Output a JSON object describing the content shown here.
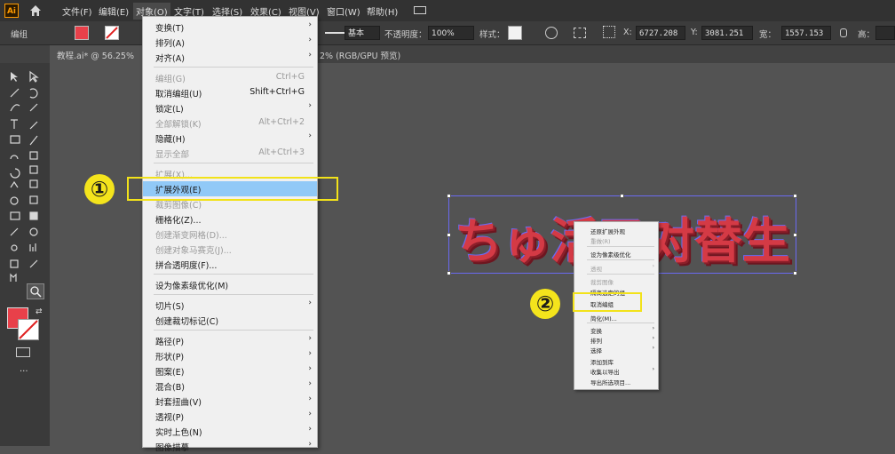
{
  "app": {
    "logo": "Ai",
    "home_icon": "home-icon"
  },
  "menubar": [
    "文件(F)",
    "编辑(E)",
    "对象(O)",
    "文字(T)",
    "选择(S)",
    "效果(C)",
    "视图(V)",
    "窗口(W)",
    "帮助(H)"
  ],
  "control": {
    "group_label": "编组",
    "stroke_style": "基本",
    "opacity_label": "不透明度：",
    "opacity_value": "100%",
    "style_label": "样式：",
    "x_label": "X:",
    "x_value": "6727.208",
    "y_label": "Y:",
    "y_value": "3081.251",
    "w_label": "宽：",
    "w_value": "1557.153",
    "h_label": "高：",
    "fill_color": "#e8404a"
  },
  "tab": {
    "doc_title": "教程.ai* @ 56.25%",
    "doc_suffix": "2% (RGB/GPU 预览)"
  },
  "object_menu": [
    {
      "label": "变换(T)",
      "shortcut": "",
      "submenu": true,
      "disabled": false
    },
    {
      "label": "排列(A)",
      "shortcut": "",
      "submenu": true,
      "disabled": false
    },
    {
      "label": "对齐(A)",
      "shortcut": "",
      "submenu": true,
      "disabled": false
    },
    {
      "label": "编组(G)",
      "shortcut": "Ctrl+G",
      "submenu": false,
      "disabled": true
    },
    {
      "label": "取消编组(U)",
      "shortcut": "Shift+Ctrl+G",
      "submenu": false,
      "disabled": false
    },
    {
      "label": "锁定(L)",
      "shortcut": "",
      "submenu": true,
      "disabled": false
    },
    {
      "label": "全部解锁(K)",
      "shortcut": "Alt+Ctrl+2",
      "submenu": false,
      "disabled": true
    },
    {
      "label": "隐藏(H)",
      "shortcut": "",
      "submenu": true,
      "disabled": false
    },
    {
      "label": "显示全部",
      "shortcut": "Alt+Ctrl+3",
      "submenu": false,
      "disabled": true
    },
    {
      "label": "扩展(X)...",
      "shortcut": "",
      "submenu": false,
      "disabled": true
    },
    {
      "label": "扩展外观(E)",
      "shortcut": "",
      "submenu": false,
      "disabled": false,
      "highlighted": true
    },
    {
      "label": "裁剪图像(C)",
      "shortcut": "",
      "submenu": false,
      "disabled": true
    },
    {
      "label": "栅格化(Z)...",
      "shortcut": "",
      "submenu": false,
      "disabled": false
    },
    {
      "label": "创建渐变网格(D)...",
      "shortcut": "",
      "submenu": false,
      "disabled": true
    },
    {
      "label": "创建对象马赛克(J)...",
      "shortcut": "",
      "submenu": false,
      "disabled": true
    },
    {
      "label": "拼合透明度(F)...",
      "shortcut": "",
      "submenu": false,
      "disabled": false
    },
    {
      "label": "设为像素级优化(M)",
      "shortcut": "",
      "submenu": false,
      "disabled": false
    },
    {
      "label": "切片(S)",
      "shortcut": "",
      "submenu": true,
      "disabled": false
    },
    {
      "label": "创建裁切标记(C)",
      "shortcut": "",
      "submenu": false,
      "disabled": false
    },
    {
      "label": "路径(P)",
      "shortcut": "",
      "submenu": true,
      "disabled": false
    },
    {
      "label": "形状(P)",
      "shortcut": "",
      "submenu": true,
      "disabled": false
    },
    {
      "label": "图案(E)",
      "shortcut": "",
      "submenu": true,
      "disabled": false
    },
    {
      "label": "混合(B)",
      "shortcut": "",
      "submenu": true,
      "disabled": false
    },
    {
      "label": "封套扭曲(V)",
      "shortcut": "",
      "submenu": true,
      "disabled": false
    },
    {
      "label": "透视(P)",
      "shortcut": "",
      "submenu": true,
      "disabled": false
    },
    {
      "label": "实时上色(N)",
      "shortcut": "",
      "submenu": true,
      "disabled": false
    },
    {
      "label": "图像描摹",
      "shortcut": "",
      "submenu": true,
      "disabled": false
    }
  ],
  "annotations": {
    "badge1": "①",
    "badge2": "②"
  },
  "artwork_text": "ちゅ活了对替生",
  "context_menu": [
    {
      "label": "还原扩展外观",
      "disabled": false,
      "submenu": false
    },
    {
      "label": "重做(R)",
      "disabled": true,
      "submenu": false
    },
    {
      "label": "设为像素级优化",
      "disabled": false,
      "submenu": false
    },
    {
      "label": "透视",
      "disabled": true,
      "submenu": true
    },
    {
      "label": "裁剪图像",
      "disabled": true,
      "submenu": false
    },
    {
      "label": "隔离选定的组",
      "disabled": false,
      "submenu": false
    },
    {
      "label": "取消编组",
      "disabled": false,
      "submenu": false
    },
    {
      "label": "简化(M)...",
      "disabled": false,
      "submenu": false
    },
    {
      "label": "变换",
      "disabled": false,
      "submenu": true
    },
    {
      "label": "排列",
      "disabled": false,
      "submenu": true
    },
    {
      "label": "选择",
      "disabled": false,
      "submenu": true
    },
    {
      "label": "添加到库",
      "disabled": false,
      "submenu": false
    },
    {
      "label": "收集以导出",
      "disabled": false,
      "submenu": true
    },
    {
      "label": "导出所选项目...",
      "disabled": false,
      "submenu": false
    }
  ]
}
